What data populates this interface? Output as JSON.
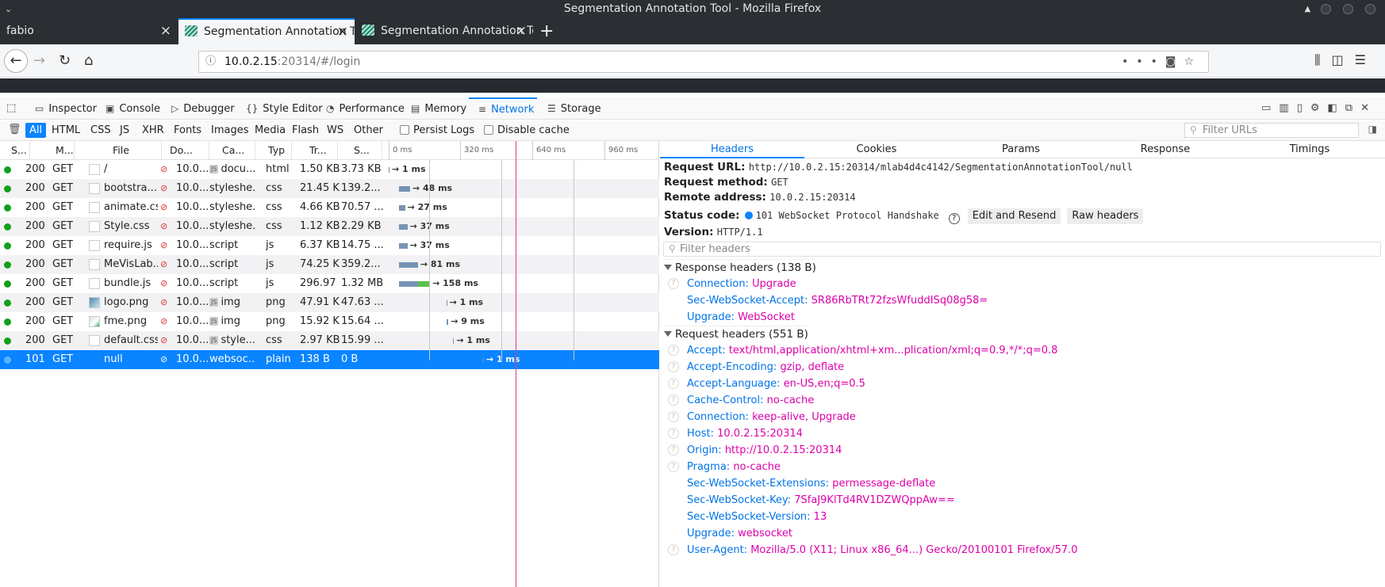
{
  "window": {
    "title": "Segmentation Annotation Tool - Mozilla Firefox"
  },
  "tabs": [
    {
      "label": "fabio"
    },
    {
      "label": "Segmentation Annotation To"
    },
    {
      "label": "Segmentation Annotation To"
    }
  ],
  "urlbar": {
    "host": "10.0.2.15",
    "rest": ":20314/#/login"
  },
  "devtools": {
    "tabs": [
      {
        "label": "Inspector",
        "icon": "inspector-icon"
      },
      {
        "label": "Console",
        "icon": "console-icon"
      },
      {
        "label": "Debugger",
        "icon": "debugger-icon"
      },
      {
        "label": "Style Editor",
        "icon": "style-editor-icon"
      },
      {
        "label": "Performance",
        "icon": "performance-icon"
      },
      {
        "label": "Memory",
        "icon": "memory-icon"
      },
      {
        "label": "Network",
        "icon": "network-icon"
      },
      {
        "label": "Storage",
        "icon": "storage-icon"
      }
    ]
  },
  "filters": {
    "types": [
      "All",
      "HTML",
      "CSS",
      "JS",
      "XHR",
      "Fonts",
      "Images",
      "Media",
      "Flash",
      "WS",
      "Other"
    ],
    "persist_logs": "Persist Logs",
    "disable_cache": "Disable cache",
    "filter_urls_placeholder": "Filter URLs"
  },
  "columns": [
    "S...",
    "M...",
    "File",
    "Do...",
    "Ca...",
    "Typ",
    "Tr...",
    "S..."
  ],
  "timeline_ticks": [
    "0 ms",
    "320 ms",
    "640 ms",
    "960 ms"
  ],
  "requests": [
    {
      "status": "200",
      "method": "GET",
      "file": "/",
      "domain": "10.0....",
      "cause": "docu...",
      "cause_js": true,
      "type": "html",
      "transferred": "1.50 KB",
      "size": "3.73 KB",
      "timing": "→ 1 ms",
      "bar_start_ms": 0,
      "bar_wait_ms": 1,
      "bar_recv_ms": 0
    },
    {
      "status": "200",
      "method": "GET",
      "file": "bootstra...",
      "domain": "10.0....",
      "cause": "styleshe...",
      "cause_js": false,
      "type": "css",
      "transferred": "21.45 KB",
      "size": "139.2...",
      "timing": "→ 48 ms",
      "bar_start_ms": 100,
      "bar_wait_ms": 48,
      "bar_recv_ms": 0
    },
    {
      "status": "200",
      "method": "GET",
      "file": "animate.css",
      "domain": "10.0....",
      "cause": "styleshe...",
      "cause_js": false,
      "type": "css",
      "transferred": "4.66 KB",
      "size": "70.57 ...",
      "timing": "→ 27 ms",
      "bar_start_ms": 100,
      "bar_wait_ms": 27,
      "bar_recv_ms": 0
    },
    {
      "status": "200",
      "method": "GET",
      "file": "Style.css",
      "domain": "10.0....",
      "cause": "styleshe...",
      "cause_js": false,
      "type": "css",
      "transferred": "1.12 KB",
      "size": "2.29 KB",
      "timing": "→ 37 ms",
      "bar_start_ms": 100,
      "bar_wait_ms": 37,
      "bar_recv_ms": 0
    },
    {
      "status": "200",
      "method": "GET",
      "file": "require.js",
      "domain": "10.0....",
      "cause": "script",
      "cause_js": false,
      "type": "js",
      "transferred": "6.37 KB",
      "size": "14.75 ...",
      "timing": "→ 37 ms",
      "bar_start_ms": 100,
      "bar_wait_ms": 37,
      "bar_recv_ms": 0
    },
    {
      "status": "200",
      "method": "GET",
      "file": "MeVisLab...",
      "domain": "10.0....",
      "cause": "script",
      "cause_js": false,
      "type": "js",
      "transferred": "74.25 KB",
      "size": "359.2...",
      "timing": "→ 81 ms",
      "bar_start_ms": 100,
      "bar_wait_ms": 81,
      "bar_recv_ms": 0
    },
    {
      "status": "200",
      "method": "GET",
      "file": "bundle.js",
      "domain": "10.0....",
      "cause": "script",
      "cause_js": false,
      "type": "js",
      "transferred": "296.97 ...",
      "size": "1.32 MB",
      "timing": "→ 158 ms",
      "bar_start_ms": 100,
      "bar_wait_ms": 80,
      "bar_recv_ms": 78
    },
    {
      "status": "200",
      "method": "GET",
      "file": "logo.png",
      "domain": "10.0....",
      "cause": "img",
      "cause_js": true,
      "type": "png",
      "transferred": "47.91 KB",
      "size": "47.63 ...",
      "timing": "→ 1 ms",
      "bar_start_ms": 580,
      "bar_wait_ms": 1,
      "bar_recv_ms": 0
    },
    {
      "status": "200",
      "method": "GET",
      "file": "fme.png",
      "domain": "10.0....",
      "cause": "img",
      "cause_js": true,
      "type": "png",
      "transferred": "15.92 KB",
      "size": "15.64 ...",
      "timing": "→ 9 ms",
      "bar_start_ms": 580,
      "bar_wait_ms": 9,
      "bar_recv_ms": 0
    },
    {
      "status": "200",
      "method": "GET",
      "file": "default.css",
      "domain": "10.0....",
      "cause": "style...",
      "cause_js": true,
      "type": "css",
      "transferred": "2.97 KB",
      "size": "15.99 ...",
      "timing": "→ 1 ms",
      "bar_start_ms": 650,
      "bar_wait_ms": 1,
      "bar_recv_ms": 0
    },
    {
      "status": "101",
      "method": "GET",
      "file": "null",
      "domain": "10.0....",
      "cause": "websoc...",
      "cause_js": false,
      "type": "plain",
      "transferred": "138 B",
      "size": "0 B",
      "timing": "→ 1 ms",
      "bar_start_ms": 950,
      "bar_wait_ms": 1,
      "bar_recv_ms": 0
    }
  ],
  "details": {
    "tabs": [
      "Headers",
      "Cookies",
      "Params",
      "Response",
      "Timings"
    ],
    "request_url_label": "Request URL:",
    "request_url": "http://10.0.2.15:20314/mlab4d4c4142/SegmentationAnnotationTool/null",
    "request_method_label": "Request method:",
    "request_method": "GET",
    "remote_address_label": "Remote address:",
    "remote_address": "10.0.2.15:20314",
    "status_code_label": "Status code:",
    "status_code": "101 WebSocket Protocol Handshake",
    "edit_resend": "Edit and Resend",
    "raw_headers": "Raw headers",
    "version_label": "Version:",
    "version": "HTTP/1.1",
    "filter_headers_placeholder": "Filter headers",
    "response_section": "Response headers (138 B)",
    "response_headers": [
      {
        "key": "Connection:",
        "value": "Upgrade",
        "help": true
      },
      {
        "key": "Sec-WebSocket-Accept:",
        "value": "SR86RbTRt72fzsWfuddISq08g58=",
        "help": false
      },
      {
        "key": "Upgrade:",
        "value": "WebSocket",
        "help": false
      }
    ],
    "request_section": "Request headers (551 B)",
    "request_headers": [
      {
        "key": "Accept:",
        "value": "text/html,application/xhtml+xm...plication/xml;q=0.9,*/*;q=0.8",
        "help": true
      },
      {
        "key": "Accept-Encoding:",
        "value": "gzip, deflate",
        "help": true
      },
      {
        "key": "Accept-Language:",
        "value": "en-US,en;q=0.5",
        "help": true
      },
      {
        "key": "Cache-Control:",
        "value": "no-cache",
        "help": true
      },
      {
        "key": "Connection:",
        "value": "keep-alive, Upgrade",
        "help": true
      },
      {
        "key": "Host:",
        "value": "10.0.2.15:20314",
        "help": true
      },
      {
        "key": "Origin:",
        "value": "http://10.0.2.15:20314",
        "help": true
      },
      {
        "key": "Pragma:",
        "value": "no-cache",
        "help": true
      },
      {
        "key": "Sec-WebSocket-Extensions:",
        "value": "permessage-deflate",
        "help": false
      },
      {
        "key": "Sec-WebSocket-Key:",
        "value": "7SfaJ9KlTd4RV1DZWQppAw==",
        "help": false
      },
      {
        "key": "Sec-WebSocket-Version:",
        "value": "13",
        "help": false
      },
      {
        "key": "Upgrade:",
        "value": "websocket",
        "help": false
      },
      {
        "key": "User-Agent:",
        "value": "Mozilla/5.0 (X11; Linux x86_64...) Gecko/20100101 Firefox/57.0",
        "help": true
      }
    ]
  },
  "colors": {
    "accent": "#0a84ff",
    "status_ok": "#12a01a",
    "header_value": "#dd00a9",
    "header_key": "#0074e8",
    "wait_bar": "#7594b4",
    "receive_bar": "#5ac04a",
    "load_line": "#e2388e"
  }
}
